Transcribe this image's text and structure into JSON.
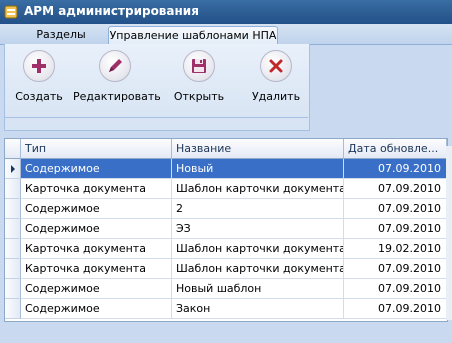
{
  "window": {
    "title": "АРМ администрирования"
  },
  "tabs": [
    {
      "label": "Разделы"
    },
    {
      "label": "Управление шаблонами НПА"
    }
  ],
  "ribbon": {
    "buttons": [
      {
        "label": "Создать",
        "icon": "plus-icon"
      },
      {
        "label": "Редактировать",
        "icon": "pencil-icon"
      },
      {
        "label": "Открыть",
        "icon": "floppy-icon"
      },
      {
        "label": "Удалить",
        "icon": "close-icon"
      }
    ]
  },
  "grid": {
    "columns": [
      "Тип",
      "Название",
      "Дата обновле..."
    ],
    "rows": [
      {
        "type": "Содержимое",
        "name": "Новый",
        "date": "07.09.2010",
        "selected": true
      },
      {
        "type": "Карточка документа",
        "name": "Шаблон карточки документа",
        "date": "07.09.2010"
      },
      {
        "type": "Содержимое",
        "name": "2",
        "date": "07.09.2010"
      },
      {
        "type": "Содержимое",
        "name": "ЭЗ",
        "date": "07.09.2010"
      },
      {
        "type": "Карточка документа",
        "name": "Шаблон карточки документа",
        "date": "19.02.2010"
      },
      {
        "type": "Карточка документа",
        "name": "Шаблон карточки документа",
        "date": "07.09.2010"
      },
      {
        "type": "Содержимое",
        "name": "Новый шаблон",
        "date": "07.09.2010"
      },
      {
        "type": "Содержимое",
        "name": "Закон",
        "date": "07.09.2010"
      }
    ]
  },
  "colors": {
    "accent": "#3a6fc7",
    "title_bar": "#2b5b91"
  }
}
